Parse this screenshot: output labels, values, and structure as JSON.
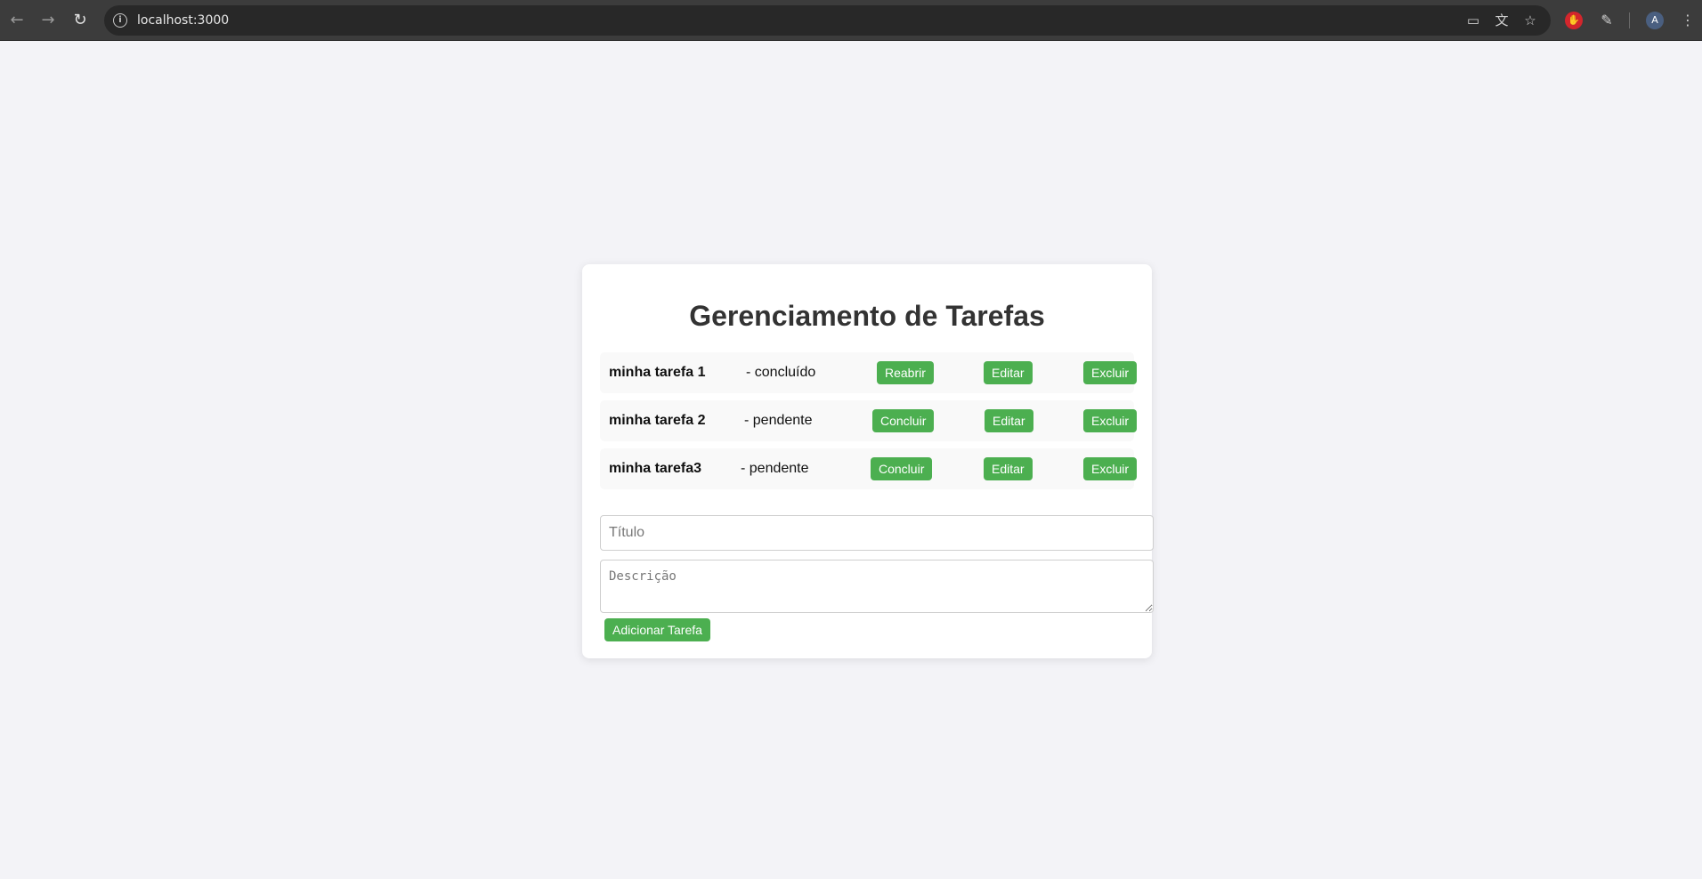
{
  "browser": {
    "url": "localhost:3000",
    "nav_icons": [
      "back-arrow-icon",
      "forward-arrow-icon",
      "reload-icon"
    ],
    "omnibox_icons": [
      "site-info-icon",
      "cast-icon",
      "translate-icon",
      "bookmark-star-icon"
    ],
    "toolbar_icons": [
      "extension-shield-icon",
      "extensions-puzzle-icon",
      "profile-avatar",
      "menu-kebab-icon"
    ],
    "avatar_letter": "A"
  },
  "app": {
    "title": "Gerenciamento de Tarefas",
    "accent_color": "#4caf50",
    "tasks": [
      {
        "title": "minha tarefa 1",
        "status": "- concluído",
        "toggle_label": "Reabrir",
        "edit_label": "Editar",
        "delete_label": "Excluir"
      },
      {
        "title": "minha tarefa 2",
        "status": "- pendente",
        "toggle_label": "Concluir",
        "edit_label": "Editar",
        "delete_label": "Excluir"
      },
      {
        "title": "minha tarefa3",
        "status": "- pendente",
        "toggle_label": "Concluir",
        "edit_label": "Editar",
        "delete_label": "Excluir"
      }
    ],
    "form": {
      "title_placeholder": "Título",
      "title_value": "",
      "description_placeholder": "Descrição",
      "description_value": "",
      "submit_label": "Adicionar Tarefa"
    }
  }
}
